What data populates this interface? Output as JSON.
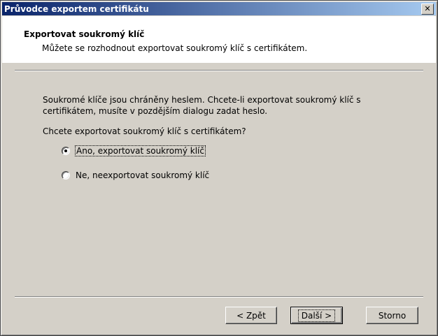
{
  "window": {
    "title": "Průvodce exportem certifikátu",
    "close": "✕"
  },
  "header": {
    "title": "Exportovat soukromý klíč",
    "subtitle": "Můžete se rozhodnout exportovat soukromý klíč s certifikátem."
  },
  "body": {
    "text": "Soukromé klíče jsou chráněny heslem. Chcete-li exportovat soukromý klíč s certifikátem, musíte v pozdějším dialogu zadat heslo.",
    "question": "Chcete exportovat soukromý klíč s certifikátem?"
  },
  "options": [
    {
      "label": "Ano, exportovat soukromý klíč",
      "selected": true
    },
    {
      "label": "Ne, neexportovat soukromý klíč",
      "selected": false
    }
  ],
  "buttons": {
    "back": "< Zpět",
    "next": "Další >",
    "cancel": "Storno"
  }
}
